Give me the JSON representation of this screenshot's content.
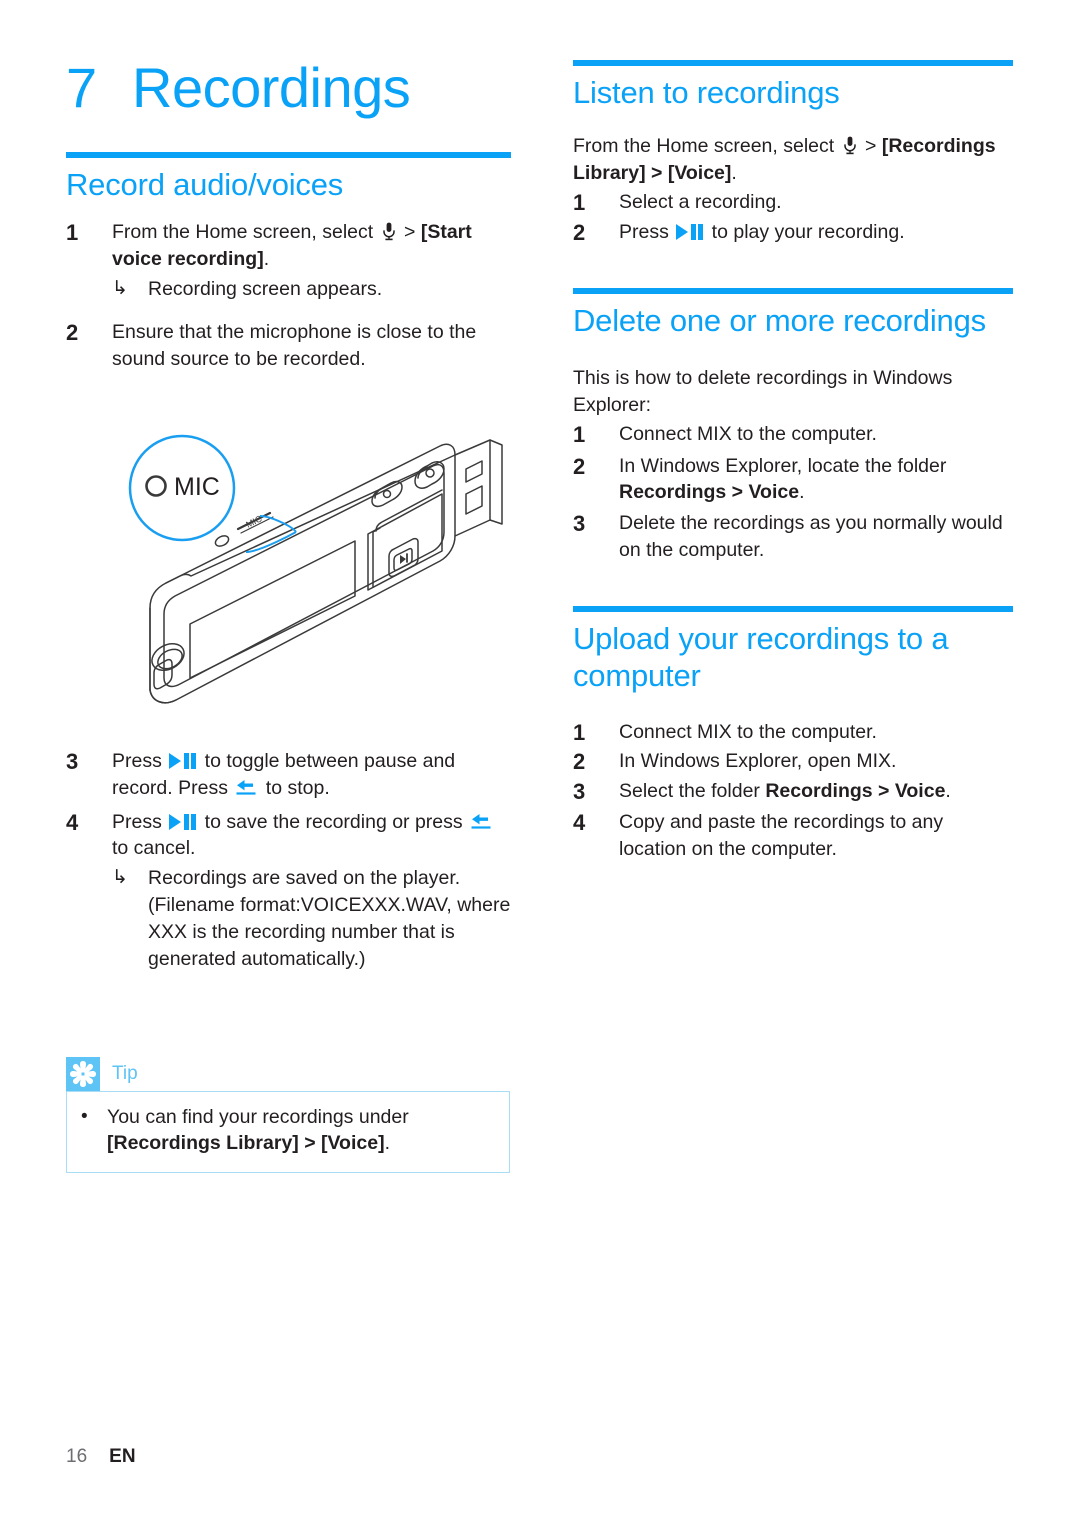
{
  "meta": {
    "accent_color": "#0AA2F7",
    "tip_icon_bg": "#5EC3F5",
    "tip_border": "#A9DCF5",
    "text_color": "#231F20"
  },
  "chapter": {
    "number": "7",
    "title": "Recordings"
  },
  "left_column": {
    "section": {
      "title": "Record audio/voices",
      "steps": [
        {
          "num": "1",
          "text_before_icon": "From the Home screen, select ",
          "icon": "microphone-icon",
          "text_after_icon": " > ",
          "bold_text": "[Start voice recording]",
          "text_end": ".",
          "subnote": {
            "arrow": "↳",
            "text": "Recording screen appears."
          }
        },
        {
          "num": "2",
          "text": "Ensure that the microphone is close to the sound source to be recorded."
        },
        {
          "num": "3",
          "seg1": "Press ",
          "icon1": "play-pause-icon",
          "seg2": " to toggle between pause and record. Press ",
          "icon2": "back-stop-icon",
          "seg3": " to stop."
        },
        {
          "num": "4",
          "seg1": "Press ",
          "icon1": "play-pause-icon",
          "seg2": " to save the recording or press ",
          "icon2": "back-stop-icon",
          "seg3": " to cancel.",
          "subnote": {
            "arrow": "↳",
            "text": "Recordings are saved on the player. (Filename format:VOICEXXX.WAV, where XXX is the recording number that is generated automatically.)"
          }
        }
      ]
    },
    "illustration": {
      "name": "philips-mix-player-illustration",
      "callout_label": "MIC",
      "device_mic_label": "MIC"
    },
    "tip": {
      "icon": "tip-asterisk-icon",
      "label": "Tip",
      "bullet_dot": "•",
      "text_plain": "You can find your recordings under ",
      "text_bold": "[Recordings Library] > [Voice]",
      "text_end": "."
    }
  },
  "right_column": {
    "listen": {
      "title": "Listen to recordings",
      "intro_before_icon": " From the Home screen, select ",
      "intro_icon": "microphone-icon",
      "intro_after_icon": " > ",
      "intro_bold": "[Recordings Library] > [Voice]",
      "intro_end": ".",
      "steps": [
        {
          "num": "1",
          "text": "Select a recording."
        },
        {
          "num": "2",
          "seg1": "Press ",
          "icon1": "play-pause-icon",
          "seg2": " to play your recording."
        }
      ]
    },
    "delete": {
      "title": "Delete one or more recordings",
      "intro": "This is how to delete recordings in Windows Explorer:",
      "steps": [
        {
          "num": "1",
          "text": "Connect MIX to the computer."
        },
        {
          "num": "2",
          "seg1": "In Windows Explorer, locate the folder ",
          "bold": "Recordings > Voice",
          "seg2": "."
        },
        {
          "num": "3",
          "text": "Delete the recordings as you normally would on the computer."
        }
      ]
    },
    "upload": {
      "title": "Upload your recordings to a computer",
      "steps": [
        {
          "num": "1",
          "text": "Connect MIX to the computer."
        },
        {
          "num": "2",
          "text": "In Windows Explorer, open MIX."
        },
        {
          "num": "3",
          "seg1": "Select the folder ",
          "bold": "Recordings > Voice",
          "seg2": "."
        },
        {
          "num": "4",
          "text": "Copy and paste the recordings to any location on the computer."
        }
      ]
    }
  },
  "footer": {
    "page_number": "16",
    "language": "EN"
  }
}
